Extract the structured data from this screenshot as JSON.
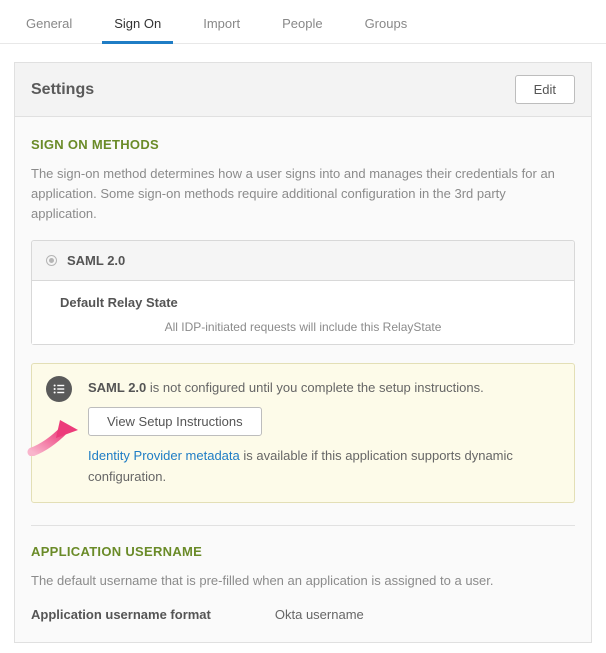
{
  "tabs": {
    "general": "General",
    "signon": "Sign On",
    "import": "Import",
    "people": "People",
    "groups": "Groups"
  },
  "settings": {
    "title": "Settings",
    "edit": "Edit"
  },
  "signon": {
    "title": "SIGN ON METHODS",
    "desc": "The sign-on method determines how a user signs into and manages their credentials for an application. Some sign-on methods require additional configuration in the 3rd party application.",
    "method": "SAML 2.0",
    "relay_label": "Default Relay State",
    "relay_note": "All IDP-initiated requests will include this RelayState",
    "callout_strong": "SAML 2.0",
    "callout_rest": " is not configured until you complete the setup instructions.",
    "view_setup": "View Setup Instructions",
    "idp_link": "Identity Provider metadata",
    "idp_rest": " is available if this application supports dynamic configuration."
  },
  "appuser": {
    "title": "APPLICATION USERNAME",
    "desc": "The default username that is pre-filled when an application is assigned to a user.",
    "k": "Application username format",
    "v": "Okta username"
  }
}
